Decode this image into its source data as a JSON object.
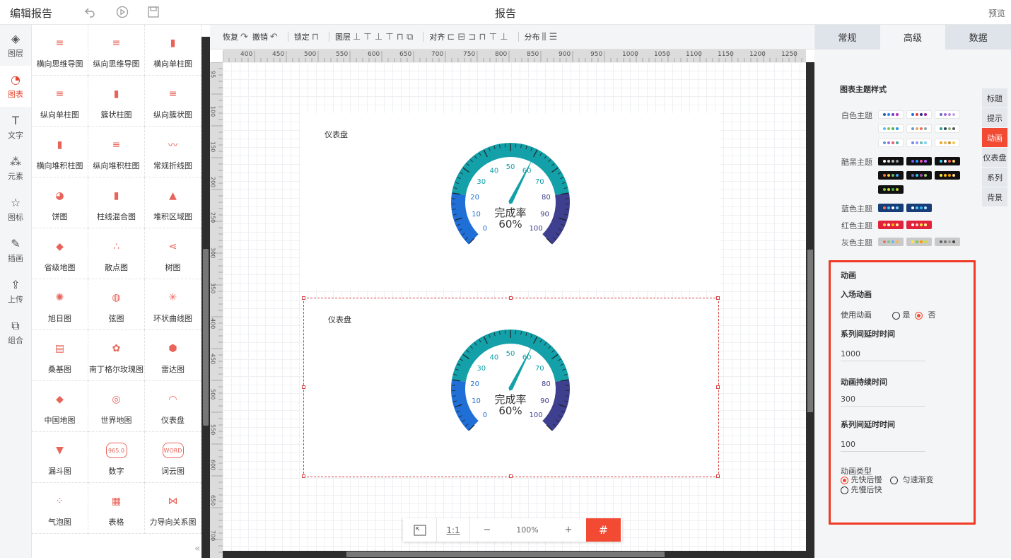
{
  "topbar": {
    "app_title": "编辑报告",
    "report_title": "报告",
    "preview": "预览",
    "icons": [
      "undo-icon",
      "play-icon",
      "save-icon"
    ]
  },
  "iconbar": [
    {
      "name": "layers",
      "label": "图层",
      "glyph": "◈"
    },
    {
      "name": "chart",
      "label": "图表",
      "glyph": "◔",
      "active": true
    },
    {
      "name": "text",
      "label": "文字",
      "glyph": "T"
    },
    {
      "name": "element",
      "label": "元素",
      "glyph": "⁂"
    },
    {
      "name": "icon",
      "label": "图标",
      "glyph": "☆"
    },
    {
      "name": "illustration",
      "label": "插画",
      "glyph": "✎"
    },
    {
      "name": "upload",
      "label": "上传",
      "glyph": "⇪"
    },
    {
      "name": "group",
      "label": "组合",
      "glyph": "⧉"
    }
  ],
  "palette": [
    {
      "label": "横向思维导图",
      "icon": "≡"
    },
    {
      "label": "纵向思维导图",
      "icon": "≡"
    },
    {
      "label": "横向单柱图",
      "icon": "▮"
    },
    {
      "label": "纵向单柱图",
      "icon": "≡"
    },
    {
      "label": "簇状柱图",
      "icon": "▮"
    },
    {
      "label": "纵向簇状图",
      "icon": "≡"
    },
    {
      "label": "横向堆积柱图",
      "icon": "▮"
    },
    {
      "label": "纵向堆积柱图",
      "icon": "≡"
    },
    {
      "label": "常规折线图",
      "icon": "〰"
    },
    {
      "label": "饼图",
      "icon": "◕"
    },
    {
      "label": "柱线混合图",
      "icon": "▮"
    },
    {
      "label": "堆积区域图",
      "icon": "▲"
    },
    {
      "label": "省级地图",
      "icon": "◆"
    },
    {
      "label": "散点图",
      "icon": "∴"
    },
    {
      "label": "树图",
      "icon": "⋖"
    },
    {
      "label": "旭日图",
      "icon": "✺"
    },
    {
      "label": "弦图",
      "icon": "◍"
    },
    {
      "label": "环状曲线图",
      "icon": "✳"
    },
    {
      "label": "桑基图",
      "icon": "▤"
    },
    {
      "label": "南丁格尔玫瑰图",
      "icon": "✿"
    },
    {
      "label": "雷达图",
      "icon": "⬢"
    },
    {
      "label": "中国地图",
      "icon": "◆"
    },
    {
      "label": "世界地图",
      "icon": "◎"
    },
    {
      "label": "仪表盘",
      "icon": "◠"
    },
    {
      "label": "漏斗图",
      "icon": "▼"
    },
    {
      "label": "数字",
      "icon": "965.0"
    },
    {
      "label": "词云图",
      "icon": "WORD"
    },
    {
      "label": "气泡图",
      "icon": "⁘"
    },
    {
      "label": "表格",
      "icon": "▦"
    },
    {
      "label": "力导向关系图",
      "icon": "⋈"
    }
  ],
  "toolbar": [
    {
      "label": "恢复",
      "glyph": "↷"
    },
    {
      "label": "撤销",
      "glyph": "↶"
    },
    {
      "sep": true
    },
    {
      "label": "锁定",
      "glyph": "⊓"
    },
    {
      "sep": true
    },
    {
      "label": "图层",
      "glyph": "⊥ ⊤ ⊥ ⊤ ⊓ ⧉"
    },
    {
      "sep": true
    },
    {
      "label": "对齐",
      "glyph": "⊏ ⊟ ⊐ ⊓ ⊤ ⊥"
    },
    {
      "sep": true
    },
    {
      "label": "分布",
      "glyph": "⫼ ☰"
    }
  ],
  "ruler": {
    "top": [
      "400",
      "450",
      "500",
      "550",
      "600",
      "650",
      "700",
      "750",
      "800",
      "850",
      "900",
      "950",
      "1000",
      "1050",
      "1100",
      "1150",
      "1200",
      "1250"
    ],
    "left": [
      "95",
      "100",
      "150",
      "200",
      "250",
      "300",
      "350",
      "400",
      "450",
      "500",
      "550",
      "600",
      "650",
      "700"
    ]
  },
  "cards": [
    {
      "title": "仪表盘",
      "gauge": {
        "value": 60,
        "min": 0,
        "max": 100,
        "label": "完成率",
        "display": "60%",
        "ticks": [
          "0",
          "10",
          "20",
          "30",
          "40",
          "50",
          "60",
          "70",
          "80",
          "90",
          "100"
        ]
      }
    },
    {
      "title": "仪表盘",
      "gauge": {
        "value": 60,
        "min": 0,
        "max": 100,
        "label": "完成率",
        "display": "60%",
        "ticks": [
          "0",
          "10",
          "20",
          "30",
          "40",
          "50",
          "60",
          "70",
          "80",
          "90",
          "100"
        ]
      }
    }
  ],
  "gauge_colors": {
    "low": "#1f6fd6",
    "mid": "#13a0a8",
    "high": "#3e3f8e",
    "needle": "#13a0a8"
  },
  "zoombar": {
    "ratio": "1:1",
    "minus": "−",
    "zoom": "100%",
    "plus": "+"
  },
  "rpanel": {
    "tabs": [
      {
        "label": "常规"
      },
      {
        "label": "高级",
        "active": true
      },
      {
        "label": "数据"
      }
    ],
    "theme_title": "图表主题样式",
    "themes": [
      {
        "label": "白色主题",
        "bg": "#ffffff",
        "swatches": [
          [
            "#2c5aa0",
            "#1e8ce0",
            "#7a3ad1",
            "#b82ec1"
          ],
          [
            "#1e6fd9",
            "#e33b3b",
            "#2c2c8e",
            "#8f1e9e"
          ],
          [
            "#6b6bd6",
            "#9b6bd6",
            "#b18ad6",
            "#c8a3e3"
          ],
          [
            "#4fc3f7",
            "#8bc34a",
            "#4caf50",
            "#2196f3"
          ],
          [
            "#5aa0d6",
            "#f4a261",
            "#e76f51",
            "#90a4ae"
          ],
          [
            "#2a9d8f",
            "#264653",
            "#8ab17d",
            "#555"
          ],
          [
            "#5a9bd5",
            "#9e6fd8",
            "#e35d6a",
            "#3ba99c"
          ],
          [
            "#6c8ee0",
            "#a78bfa",
            "#55c3b0",
            "#7cd1f0"
          ],
          [
            "#f4a223",
            "#e3b35b",
            "#c8932a",
            "#f7c25a"
          ]
        ]
      },
      {
        "label": "酷黑主题",
        "bg": "#111111",
        "swatches": [
          [
            "#ffffff",
            "#dddddd",
            "#bbbbbb",
            "#999999"
          ],
          [
            "#7b5cff",
            "#1ea0ff",
            "#ff4da6",
            "#b35cff"
          ],
          [
            "#3ad6ff",
            "#ffffff",
            "#ff5a5a",
            "#ffd54f"
          ],
          [
            "#ff7043",
            "#ffca28",
            "#66bb6a",
            "#42a5f5"
          ],
          [
            "#5c6bc0",
            "#26c6da",
            "#ab47bc",
            "#9ccc65"
          ],
          [
            "#ffeb3b",
            "#ffc107",
            "#ff9800",
            "#ffe082"
          ],
          [
            "#8bc34a",
            "#cddc39",
            "#4caf50",
            "#c0ca33"
          ]
        ]
      },
      {
        "label": "蓝色主题",
        "bg": "#173d78",
        "swatches": [
          [
            "#ff7043",
            "#4fc3f7",
            "#ffffff",
            "#81d4fa"
          ],
          [
            "#ffffff",
            "#4fc3f7",
            "#29b6f6",
            "#b3e5fc"
          ]
        ]
      },
      {
        "label": "红色主题",
        "bg": "#e0233b",
        "swatches": [
          [
            "#ffd54f",
            "#ffffff",
            "#ffb300",
            "#ffecb3"
          ],
          [
            "#ffffff",
            "#ffcdd2",
            "#ffeb3b",
            "#fff59d"
          ]
        ]
      },
      {
        "label": "灰色主题",
        "bg": "#c9c9c9",
        "swatches": [
          [
            "#e57373",
            "#81c784",
            "#64b5f6",
            "#ffb74d"
          ],
          [
            "#ffeb3b",
            "#8bc34a",
            "#ff9800",
            "#cddc39"
          ],
          [
            "#616161",
            "#757575",
            "#9e9e9e",
            "#424242"
          ]
        ]
      }
    ],
    "side_tabs": [
      {
        "label": "标题"
      },
      {
        "label": "提示"
      },
      {
        "label": "动画",
        "active": true
      },
      {
        "label": "仪表盘"
      },
      {
        "label": "系列"
      },
      {
        "label": "背景"
      }
    ],
    "animation": {
      "section": "动画",
      "entry": "入场动画",
      "use_label": "使用动画",
      "yes": "是",
      "no": "否",
      "delay1_label": "系列间延时时间",
      "delay1_value": "1000",
      "duration_label": "动画持续时间",
      "duration_value": "300",
      "delay2_label": "系列间延时时间",
      "delay2_value": "100",
      "type_label": "动画类型",
      "type_options": [
        "先快后慢",
        "匀速渐变",
        "先慢后快"
      ]
    }
  }
}
